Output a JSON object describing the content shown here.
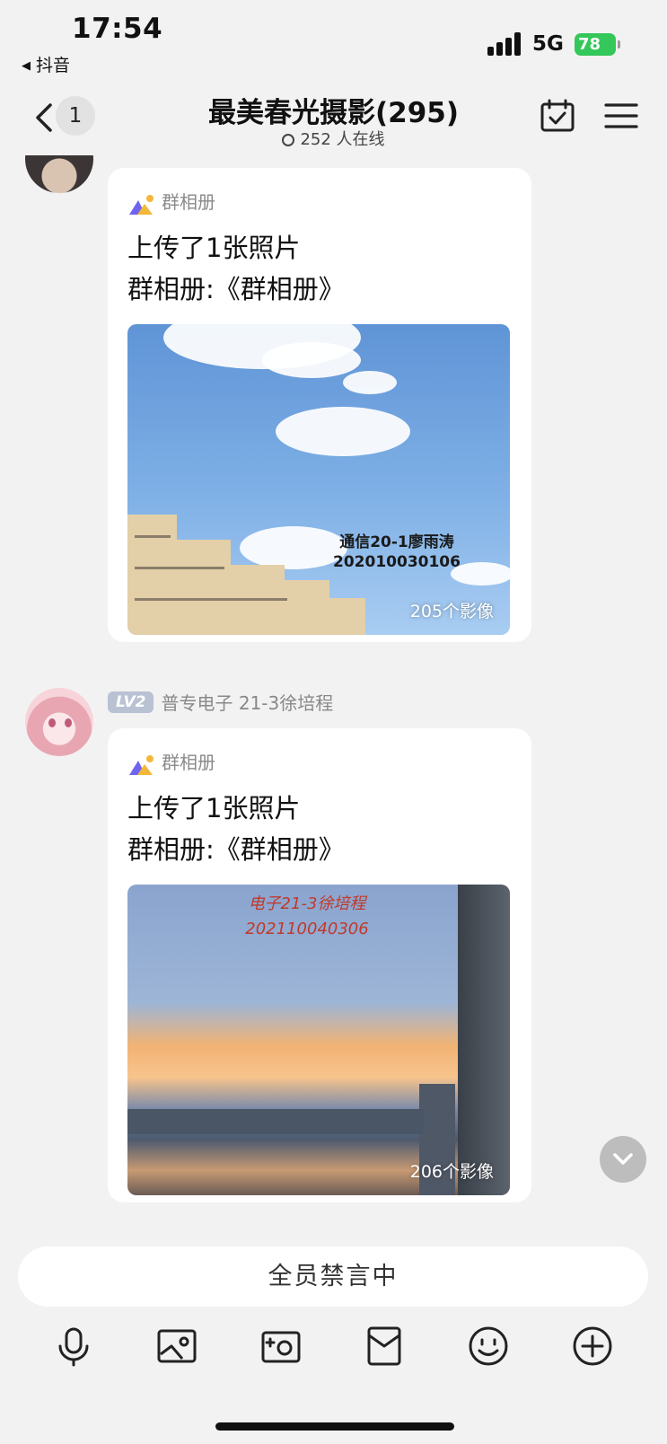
{
  "status_bar": {
    "time": "17:54",
    "back_app": "抖音",
    "network": "5G",
    "battery": "78"
  },
  "header": {
    "unread_count": "1",
    "title": "最美春光摄影(295)",
    "online": "252 人在线"
  },
  "messages": [
    {
      "album_label": "群相册",
      "line1": "上传了1张照片",
      "line2": "群相册:《群相册》",
      "photo_caption_line1": "通信20-1廖雨涛",
      "photo_caption_line2": "202010030106",
      "photo_count": "205个影像"
    },
    {
      "level": "LV2",
      "sender": "普专电子 21-3徐培程",
      "album_label": "群相册",
      "line1": "上传了1张照片",
      "line2": "群相册:《群相册》",
      "photo_caption_line1": "电子21-3徐培程",
      "photo_caption_line2": "202110040306",
      "photo_count": "206个影像"
    }
  ],
  "input": {
    "muted_text": "全员禁言中"
  },
  "toolbar_icons": [
    "microphone-icon",
    "image-icon",
    "camera-icon",
    "red-packet-icon",
    "emoji-icon",
    "plus-icon"
  ]
}
